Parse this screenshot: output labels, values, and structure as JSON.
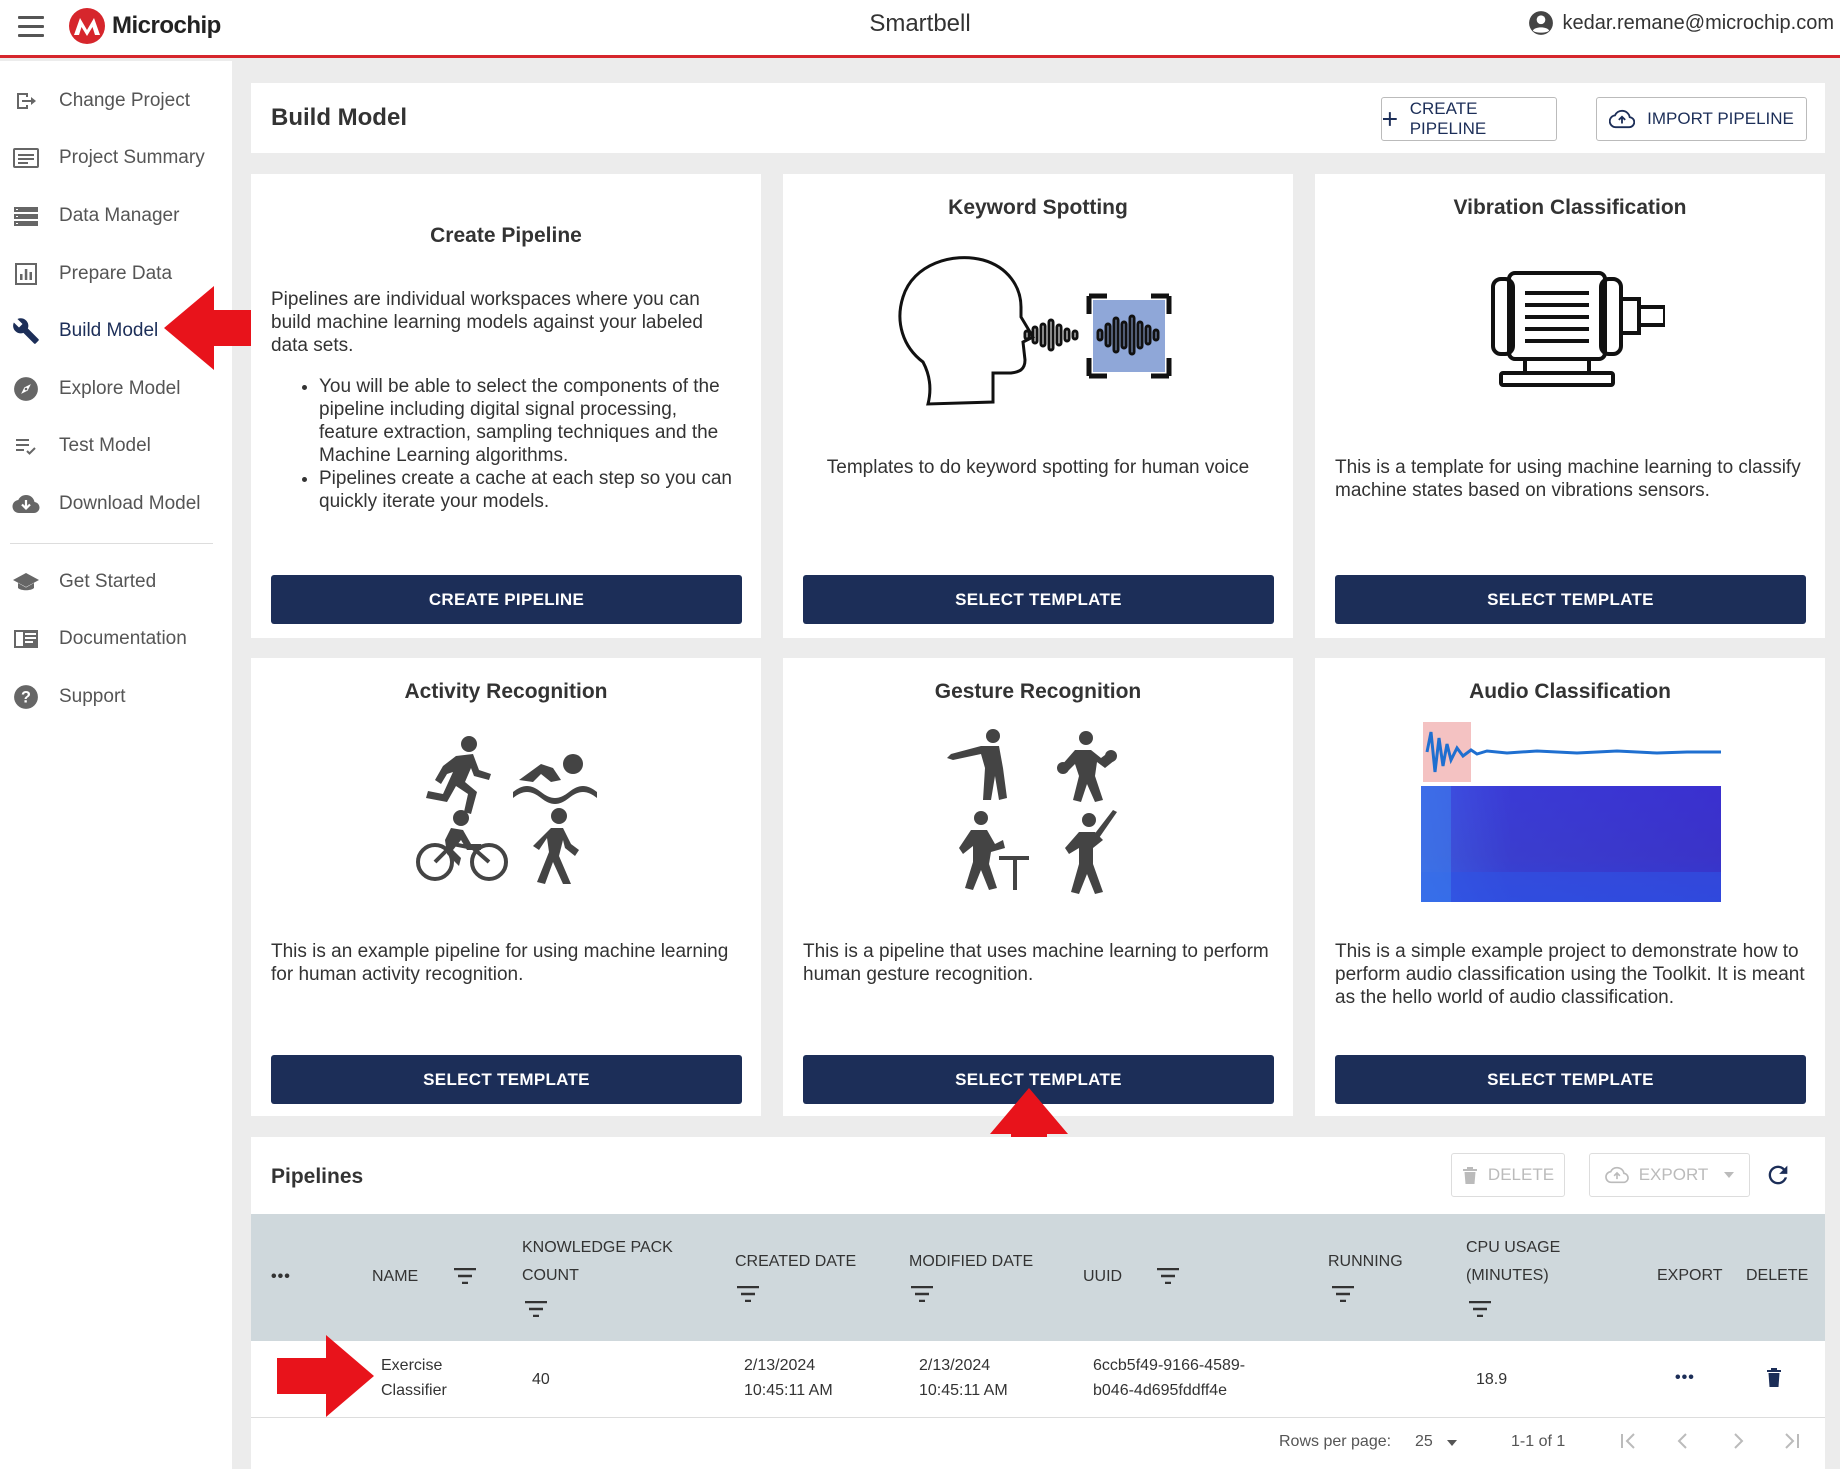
{
  "topbar": {
    "logo_text": "Microchip",
    "app_title": "Smartbell",
    "user_email": "kedar.remane@microchip.com"
  },
  "sidebar": {
    "items": [
      {
        "label": "Change Project",
        "icon": "change-project-icon"
      },
      {
        "label": "Project Summary",
        "icon": "project-summary-icon"
      },
      {
        "label": "Data Manager",
        "icon": "data-manager-icon"
      },
      {
        "label": "Prepare Data",
        "icon": "prepare-data-icon"
      },
      {
        "label": "Build Model",
        "icon": "wrench-icon",
        "active": true
      },
      {
        "label": "Explore Model",
        "icon": "compass-icon"
      },
      {
        "label": "Test Model",
        "icon": "test-model-icon"
      },
      {
        "label": "Download Model",
        "icon": "cloud-download-icon"
      }
    ],
    "secondary_items": [
      {
        "label": "Get Started",
        "icon": "graduation-cap-icon"
      },
      {
        "label": "Documentation",
        "icon": "documentation-icon"
      },
      {
        "label": "Support",
        "icon": "help-icon"
      }
    ]
  },
  "header": {
    "title": "Build Model",
    "create_pipeline_label": "CREATE PIPELINE",
    "import_pipeline_label": "IMPORT PIPELINE"
  },
  "cards": [
    {
      "title": "Create Pipeline",
      "intro": "Pipelines are individual workspaces where you can build machine learning models against your labeled data sets.",
      "bullets": [
        "You will be able to select the components of the pipeline including digital signal processing, feature extraction, sampling techniques and the Machine Learning algorithms.",
        "Pipelines create a cache at each step so you can quickly iterate your models."
      ],
      "button": "CREATE PIPELINE"
    },
    {
      "title": "Keyword Spotting",
      "description": "Templates to do keyword spotting for human voice",
      "button": "SELECT TEMPLATE"
    },
    {
      "title": "Vibration Classification",
      "description": "This is a template for using machine learning to classify machine states based on vibrations sensors.",
      "button": "SELECT TEMPLATE"
    },
    {
      "title": "Activity Recognition",
      "description": "This is an example pipeline for using machine learning for human activity recognition.",
      "button": "SELECT TEMPLATE"
    },
    {
      "title": "Gesture Recognition",
      "description": "This is a pipeline that uses machine learning to perform human gesture recognition.",
      "button": "SELECT TEMPLATE"
    },
    {
      "title": "Audio Classification",
      "description": "This is a simple example project to demonstrate how to perform audio classification using the Toolkit. It is meant as the hello world of audio classification.",
      "button": "SELECT TEMPLATE"
    }
  ],
  "pipelines": {
    "title": "Pipelines",
    "delete_label": "DELETE",
    "export_label": "EXPORT",
    "columns": {
      "more": "•••",
      "name": "NAME",
      "kp_count_1": "KNOWLEDGE PACK",
      "kp_count_2": "COUNT",
      "created": "CREATED DATE",
      "modified": "MODIFIED DATE",
      "uuid": "UUID",
      "running": "RUNNING",
      "cpu_1": "CPU USAGE",
      "cpu_2": "(MINUTES)",
      "export": "EXPORT",
      "delete": "DELETE"
    },
    "rows": [
      {
        "name_1": "Exercise",
        "name_2": "Classifier",
        "kp_count": "40",
        "created_1": "2/13/2024",
        "created_2": "10:45:11 AM",
        "modified_1": "2/13/2024",
        "modified_2": "10:45:11 AM",
        "uuid_1": "6ccb5f49-9166-4589-",
        "uuid_2": "b046-4d695fddff4e",
        "running": "",
        "cpu": "18.9",
        "export_action": "•••"
      }
    ],
    "pagination": {
      "rows_per_page_label": "Rows per page:",
      "rows_per_page": "25",
      "range": "1-1 of 1"
    }
  },
  "colors": {
    "primary": "#1c2e58",
    "accent_red": "#d6262c",
    "annotation_red": "#e8131b",
    "table_header": "#cfd8dc"
  }
}
